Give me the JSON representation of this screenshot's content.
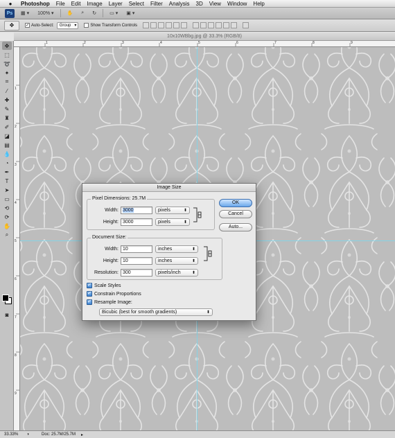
{
  "menubar": {
    "app_name": "Photoshop",
    "items": [
      "File",
      "Edit",
      "Image",
      "Layer",
      "Select",
      "Filter",
      "Analysis",
      "3D",
      "View",
      "Window",
      "Help"
    ]
  },
  "appbar": {
    "logo": "Ps",
    "zoom": "100%"
  },
  "options": {
    "auto_select_label": "Auto-Select:",
    "auto_select_value": "Group",
    "transform_label": "Show Transform Controls"
  },
  "document": {
    "title": "10x10WBbg.jpg @ 33.3% (RGB/8)"
  },
  "rulers": {
    "top": [
      "1",
      "2",
      "3",
      "4",
      "5",
      "6",
      "7",
      "8",
      "9"
    ],
    "left": [
      "1",
      "2",
      "3",
      "4",
      "5",
      "6",
      "7",
      "8",
      "9"
    ]
  },
  "status": {
    "zoom": "33.33%",
    "doc": "Doc: 25.7M/25.7M"
  },
  "dialog": {
    "title": "Image Size",
    "pixel_dimensions_label": "Pixel Dimensions:",
    "pixel_dimensions_value": "25.7M",
    "width_label": "Width:",
    "width_value": "3000",
    "width_unit": "pixels",
    "height_label": "Height:",
    "height_value": "3000",
    "height_unit": "pixels",
    "document_size_label": "Document Size:",
    "doc_width_label": "Width:",
    "doc_width_value": "10",
    "doc_width_unit": "inches",
    "doc_height_label": "Height:",
    "doc_height_value": "10",
    "doc_height_unit": "inches",
    "resolution_label": "Resolution:",
    "resolution_value": "300",
    "resolution_unit": "pixels/inch",
    "scale_styles": "Scale Styles",
    "constrain": "Constrain Proportions",
    "resample": "Resample Image:",
    "resample_method": "Bicubic (best for smooth gradients)",
    "ok": "OK",
    "cancel": "Cancel",
    "auto": "Auto..."
  },
  "colors": {
    "canvas_bg": "#bdbdbd",
    "pattern": "#e4e4e4",
    "guide": "#84d3e6"
  }
}
